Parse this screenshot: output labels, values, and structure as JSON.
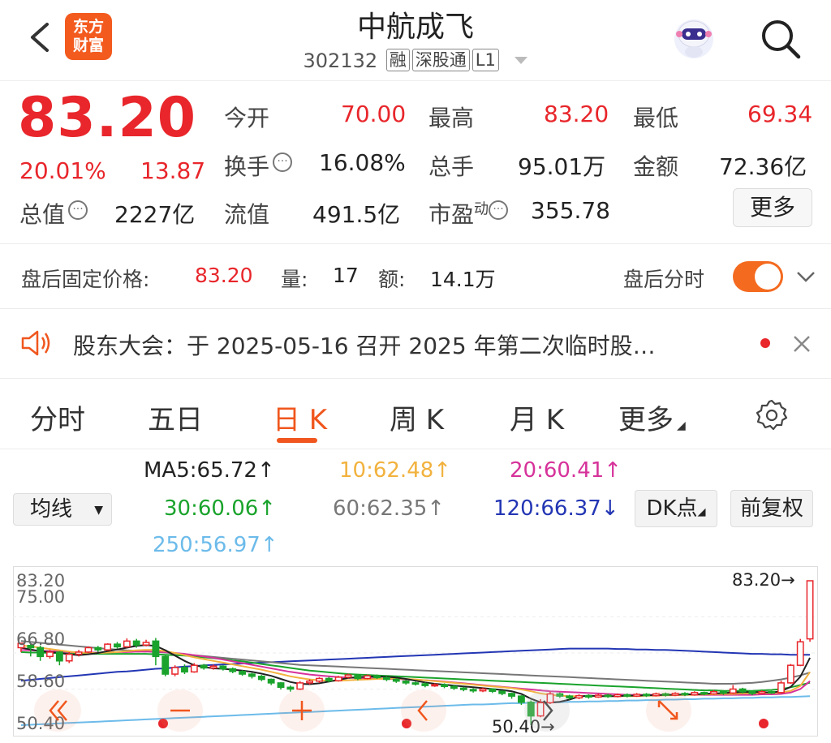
{
  "header": {
    "back_icon": "chevron-left-icon",
    "logo_line1": "东方",
    "logo_line2": "财富",
    "title": "中航成飞",
    "code": "302132",
    "tags": [
      "融",
      "深股通",
      "L1"
    ],
    "search_icon": "search-icon",
    "avatar_icon": "robot-avatar-icon"
  },
  "quote": {
    "price": "83.20",
    "change_pct": "20.01%",
    "change_amt": "13.87",
    "open_label": "今开",
    "open": "70.00",
    "high_label": "最高",
    "high": "83.20",
    "low_label": "最低",
    "low": "69.34",
    "turnover_label": "换手",
    "turnover": "16.08%",
    "volume_label": "总手",
    "volume": "95.01万",
    "amount_label": "金额",
    "amount": "72.36亿",
    "mktcap_label": "总值",
    "mktcap": "2227亿",
    "float_label": "流值",
    "float": "491.5亿",
    "pe_label": "市盈",
    "pe_sup": "动",
    "pe": "355.78",
    "more_label": "更多"
  },
  "after_hours": {
    "price_label": "盘后固定价格:",
    "price": "83.20",
    "vol_label": "量:",
    "vol": "17",
    "amt_label": "额:",
    "amt": "14.1万",
    "toggle_label": "盘后分时",
    "toggle_on": true
  },
  "notice": {
    "text": "股东大会：于 2025-05-16 召开 2025 年第二次临时股…"
  },
  "tabs": [
    {
      "label": "分时"
    },
    {
      "label": "五日"
    },
    {
      "label": "日 K",
      "active": true
    },
    {
      "label": "周 K"
    },
    {
      "label": "月 K"
    },
    {
      "label": "更多"
    }
  ],
  "ma": {
    "selector_label": "均线",
    "ma5": "MA5:65.72↑",
    "ma10": "10:62.48↑",
    "ma20": "20:60.41↑",
    "ma30": "30:60.06↑",
    "ma60": "60:62.35↑",
    "ma120": "120:66.37↓",
    "ma250": "250:56.97↑",
    "dk_label": "DK点",
    "fq_label": "前复权",
    "colors": {
      "ma5": "#222222",
      "ma10": "#f2b23e",
      "ma20": "#d6329a",
      "ma30": "#1aa32c",
      "ma60": "#777777",
      "ma120": "#2336b4",
      "ma250": "#6cbbea"
    }
  },
  "chart_data": {
    "type": "candlestick",
    "y_tick_labels": [
      "83.20",
      "75.00",
      "66.80",
      "58.60",
      "50.40"
    ],
    "ylim": [
      50.4,
      83.2
    ],
    "max_label": "83.20→",
    "min_label": "50.40→",
    "up_color": "#e8262b",
    "down_color": "#1aa32c",
    "candles": [
      [
        68,
        69,
        67,
        68.5
      ],
      [
        68.5,
        68,
        66,
        69
      ],
      [
        68,
        66,
        65,
        68.5
      ],
      [
        66,
        67,
        65.5,
        67.5
      ],
      [
        67,
        65,
        64,
        67.2
      ],
      [
        65,
        66.5,
        64.5,
        67
      ],
      [
        66.5,
        67,
        66,
        67.5
      ],
      [
        67,
        68,
        66.8,
        68.3
      ],
      [
        68,
        67.5,
        67,
        68.4
      ],
      [
        67.5,
        68.8,
        67.3,
        69
      ],
      [
        68.8,
        68.2,
        67.8,
        69.3
      ],
      [
        68.2,
        69.5,
        68,
        70.1
      ],
      [
        69.5,
        68.6,
        68,
        70
      ],
      [
        68.6,
        69.2,
        68.3,
        69.8
      ],
      [
        69.5,
        66,
        64,
        70.2
      ],
      [
        66,
        62,
        61.5,
        66.3
      ],
      [
        62,
        63.5,
        61.5,
        64
      ],
      [
        63.5,
        62.5,
        62,
        64.2
      ],
      [
        62.5,
        64,
        62.3,
        64.5
      ],
      [
        64,
        63.4,
        63,
        64.3
      ],
      [
        63.4,
        63.8,
        63,
        64.2
      ],
      [
        63.8,
        63.2,
        62.8,
        64
      ],
      [
        63.2,
        62.6,
        62.2,
        63.5
      ],
      [
        62.6,
        62,
        61.6,
        62.9
      ],
      [
        62,
        61.5,
        61,
        62.3
      ],
      [
        61.5,
        60.8,
        60.4,
        61.8
      ],
      [
        60.8,
        60,
        59.5,
        61
      ],
      [
        60,
        59,
        58.5,
        60.2
      ],
      [
        59,
        58.6,
        58,
        59.4
      ],
      [
        58.6,
        60,
        58.4,
        60.4
      ],
      [
        60,
        60.4,
        59.6,
        60.8
      ],
      [
        60.4,
        61,
        60,
        61.3
      ],
      [
        61,
        60.5,
        60.1,
        61.4
      ],
      [
        60.5,
        61.3,
        60.3,
        61.6
      ],
      [
        61.3,
        61.8,
        61,
        62.1
      ],
      [
        61.8,
        61,
        60.6,
        62
      ],
      [
        61,
        61.6,
        60.8,
        61.9
      ],
      [
        61.6,
        61.2,
        60.9,
        61.9
      ],
      [
        61.2,
        60.8,
        60.4,
        61.5
      ],
      [
        60.8,
        60.4,
        60,
        61.1
      ],
      [
        60.4,
        60,
        59.6,
        60.7
      ],
      [
        60,
        59.8,
        59.4,
        60.3
      ],
      [
        59.8,
        59.4,
        59,
        60.1
      ],
      [
        59.4,
        59.6,
        59.1,
        59.9
      ],
      [
        59.6,
        59.2,
        58.8,
        59.9
      ],
      [
        59.2,
        58.8,
        58.4,
        59.5
      ],
      [
        58.8,
        58.5,
        58.1,
        59.1
      ],
      [
        58.5,
        58.2,
        57.8,
        58.8
      ],
      [
        58.2,
        58.6,
        57.9,
        58.9
      ],
      [
        58.6,
        58.1,
        57.7,
        58.8
      ],
      [
        58.1,
        57.6,
        57.2,
        58.3
      ],
      [
        57.6,
        57,
        56.4,
        57.8
      ],
      [
        57,
        55.6,
        55,
        57.2
      ],
      [
        55.6,
        52.5,
        50.4,
        56
      ],
      [
        52.5,
        55.5,
        52.2,
        56.3
      ],
      [
        55.5,
        57.5,
        55.2,
        58
      ],
      [
        57.5,
        57,
        56.6,
        57.8
      ],
      [
        57,
        56.6,
        56.2,
        57.3
      ],
      [
        56.6,
        57.1,
        56.3,
        57.4
      ],
      [
        57.1,
        56.8,
        56.4,
        57.4
      ],
      [
        56.8,
        57.2,
        56.6,
        57.6
      ],
      [
        57.2,
        56.9,
        56.6,
        57.5
      ],
      [
        56.9,
        57.3,
        56.7,
        57.6
      ],
      [
        57.3,
        57,
        56.7,
        57.6
      ],
      [
        57,
        57.4,
        56.8,
        57.7
      ],
      [
        57.4,
        57.1,
        56.8,
        57.7
      ],
      [
        57.1,
        57.5,
        56.9,
        57.8
      ],
      [
        57.5,
        57.2,
        56.9,
        57.8
      ],
      [
        57.2,
        57.6,
        57,
        57.9
      ],
      [
        57.6,
        57.3,
        57,
        57.9
      ],
      [
        57.3,
        57.8,
        57.1,
        58.1
      ],
      [
        57.8,
        57.5,
        57.2,
        58
      ],
      [
        57.5,
        58,
        57.3,
        58.4
      ],
      [
        58,
        57.7,
        57.3,
        58.3
      ],
      [
        57.7,
        58.6,
        57.5,
        59.5
      ],
      [
        58.6,
        58,
        57.6,
        58.9
      ],
      [
        58,
        57.6,
        57.2,
        58.3
      ],
      [
        57.6,
        58,
        57.4,
        58.3
      ],
      [
        58,
        57.8,
        57.5,
        58.2
      ],
      [
        57.8,
        60,
        57.6,
        60.5
      ],
      [
        60,
        64,
        59.8,
        64.3
      ],
      [
        64,
        69.34,
        63.8,
        70
      ],
      [
        70,
        83.2,
        69.34,
        83.2
      ]
    ],
    "ma_series": {
      "ma5": [
        68,
        67.6,
        67.2,
        67,
        66.8,
        66.5,
        66.3,
        66.5,
        66.8,
        67.2,
        67.6,
        68,
        68.4,
        68.6,
        68.4,
        67.4,
        66.2,
        65,
        64,
        63.6,
        63.3,
        63.2,
        63,
        62.8,
        62.5,
        62.1,
        61.6,
        60.9,
        60.2,
        59.8,
        59.7,
        59.9,
        60.3,
        60.7,
        61.1,
        61.3,
        61.4,
        61.4,
        61.4,
        61.2,
        60.9,
        60.5,
        60.1,
        59.8,
        59.6,
        59.4,
        59.2,
        59,
        58.8,
        58.6,
        58.4,
        58.1,
        57.5,
        56.4,
        55.6,
        55.5,
        55.7,
        56.2,
        56.9,
        57.1,
        57,
        57,
        57,
        57.1,
        57.1,
        57.2,
        57.2,
        57.3,
        57.3,
        57.4,
        57.4,
        57.5,
        57.6,
        57.7,
        57.8,
        57.9,
        57.9,
        57.9,
        57.8,
        58.1,
        59.1,
        61.4,
        65.72
      ],
      "ma10": [
        68.5,
        68.3,
        68,
        67.7,
        67.4,
        67.1,
        66.9,
        66.8,
        66.8,
        66.9,
        67,
        67.2,
        67.4,
        67.5,
        67.5,
        67.2,
        66.8,
        66.3,
        65.8,
        65.4,
        65,
        64.6,
        64.2,
        63.8,
        63.4,
        63,
        62.5,
        62,
        61.5,
        61.1,
        60.8,
        60.6,
        60.5,
        60.5,
        60.6,
        60.7,
        60.8,
        60.9,
        61,
        61,
        60.9,
        60.8,
        60.6,
        60.4,
        60.2,
        60,
        59.8,
        59.6,
        59.4,
        59.2,
        59,
        58.8,
        58.5,
        58.1,
        57.6,
        57.3,
        57.1,
        57,
        57,
        57,
        57,
        57,
        57,
        57,
        57,
        57.1,
        57.1,
        57.2,
        57.2,
        57.3,
        57.3,
        57.4,
        57.4,
        57.5,
        57.5,
        57.6,
        57.6,
        57.7,
        57.7,
        57.8,
        58.2,
        59.3,
        62.48
      ],
      "ma20": [
        67.5,
        67.4,
        67.3,
        67.2,
        67.1,
        67,
        66.9,
        66.9,
        66.9,
        66.9,
        67,
        67,
        67.1,
        67.1,
        67.1,
        67,
        66.8,
        66.6,
        66.3,
        66,
        65.7,
        65.3,
        64.9,
        64.5,
        64.1,
        63.7,
        63.3,
        62.9,
        62.5,
        62.2,
        61.9,
        61.7,
        61.5,
        61.3,
        61.2,
        61.1,
        61,
        61,
        60.9,
        60.9,
        60.8,
        60.7,
        60.6,
        60.5,
        60.3,
        60.1,
        59.9,
        59.7,
        59.5,
        59.3,
        59.1,
        58.9,
        58.7,
        58.5,
        58.3,
        58.1,
        58,
        57.9,
        57.8,
        57.7,
        57.6,
        57.5,
        57.4,
        57.3,
        57.3,
        57.3,
        57.3,
        57.3,
        57.3,
        57.3,
        57.3,
        57.3,
        57.3,
        57.3,
        57.3,
        57.3,
        57.3,
        57.4,
        57.4,
        57.5,
        57.8,
        58.6,
        60.41
      ],
      "ma30": [
        67,
        66.9,
        66.9,
        66.8,
        66.8,
        66.7,
        66.7,
        66.6,
        66.6,
        66.6,
        66.6,
        66.6,
        66.6,
        66.6,
        66.5,
        66.4,
        66.3,
        66.2,
        66,
        65.8,
        65.6,
        65.4,
        65.1,
        64.9,
        64.6,
        64.3,
        64,
        63.7,
        63.4,
        63.1,
        62.8,
        62.6,
        62.4,
        62.2,
        62,
        61.9,
        61.8,
        61.7,
        61.6,
        61.5,
        61.4,
        61.3,
        61.2,
        61.1,
        61,
        60.9,
        60.8,
        60.7,
        60.6,
        60.5,
        60.4,
        60.3,
        60.2,
        60.1,
        60,
        59.9,
        59.8,
        59.7,
        59.6,
        59.5,
        59.4,
        59.3,
        59.2,
        59.1,
        59,
        58.9,
        58.8,
        58.7,
        58.6,
        58.5,
        58.4,
        58.3,
        58.3,
        58.2,
        58.2,
        58.2,
        58.2,
        58.3,
        58.4,
        58.6,
        59,
        59.5,
        60.06
      ],
      "ma60": [
        69.5,
        69.3,
        69.1,
        68.9,
        68.7,
        68.5,
        68.3,
        68.1,
        67.9,
        67.7,
        67.6,
        67.4,
        67.3,
        67.2,
        67,
        66.9,
        66.7,
        66.5,
        66.3,
        66.1,
        65.9,
        65.7,
        65.5,
        65.3,
        65.1,
        64.9,
        64.7,
        64.5,
        64.3,
        64.1,
        64,
        63.9,
        63.8,
        63.7,
        63.6,
        63.5,
        63.4,
        63.3,
        63.2,
        63.1,
        63,
        62.9,
        62.8,
        62.7,
        62.6,
        62.5,
        62.4,
        62.3,
        62.2,
        62.1,
        62,
        61.9,
        61.8,
        61.7,
        61.6,
        61.5,
        61.4,
        61.3,
        61.2,
        61.1,
        61,
        60.9,
        60.8,
        60.7,
        60.6,
        60.5,
        60.4,
        60.3,
        60.2,
        60.1,
        60,
        59.9,
        59.8,
        59.8,
        59.8,
        59.9,
        60,
        60.2,
        60.5,
        60.8,
        61.2,
        61.7,
        62.35
      ],
      "ma120": [
        60.5,
        60.7,
        60.9,
        61.1,
        61.3,
        61.5,
        61.7,
        61.9,
        62.1,
        62.3,
        62.5,
        62.6,
        62.8,
        63,
        63.2,
        63.3,
        63.5,
        63.7,
        63.8,
        64,
        64.1,
        64.2,
        64.3,
        64.4,
        64.5,
        64.6,
        64.7,
        64.8,
        64.9,
        65,
        65.1,
        65.2,
        65.3,
        65.4,
        65.5,
        65.6,
        65.7,
        65.8,
        65.9,
        66,
        66.1,
        66.2,
        66.3,
        66.4,
        66.5,
        66.6,
        66.7,
        66.8,
        66.9,
        67,
        67.1,
        67.2,
        67.3,
        67.4,
        67.5,
        67.6,
        67.7,
        67.8,
        67.8,
        67.8,
        67.8,
        67.8,
        67.7,
        67.7,
        67.6,
        67.6,
        67.5,
        67.5,
        67.4,
        67.3,
        67.2,
        67.1,
        67,
        66.9,
        66.8,
        66.7,
        66.6,
        66.6,
        66.5,
        66.5,
        66.4,
        66.4,
        66.37
      ],
      "ma250": [
        50.4,
        50.5,
        50.6,
        50.7,
        50.8,
        50.9,
        51,
        51.1,
        51.2,
        51.3,
        51.4,
        51.5,
        51.6,
        51.7,
        51.8,
        51.9,
        52,
        52.1,
        52.2,
        52.3,
        52.4,
        52.5,
        52.6,
        52.7,
        52.8,
        52.9,
        53,
        53.1,
        53.2,
        53.3,
        53.4,
        53.5,
        53.6,
        53.7,
        53.8,
        53.9,
        54,
        54.1,
        54.2,
        54.3,
        54.4,
        54.5,
        54.6,
        54.7,
        54.8,
        54.9,
        55,
        55.1,
        55.1,
        55.2,
        55.3,
        55.4,
        55.4,
        55.5,
        55.5,
        55.6,
        55.6,
        55.7,
        55.7,
        55.8,
        55.8,
        55.9,
        55.9,
        56,
        56,
        56.1,
        56.1,
        56.2,
        56.2,
        56.3,
        56.3,
        56.4,
        56.4,
        56.5,
        56.5,
        56.6,
        56.6,
        56.7,
        56.7,
        56.8,
        56.8,
        56.9,
        56.97
      ]
    }
  },
  "chart_controls": {
    "icons": [
      "double-chevron-left-icon",
      "minus-icon",
      "plus-icon",
      "chevron-left-icon",
      "chevron-right-icon",
      "expand-arrows-icon"
    ]
  }
}
